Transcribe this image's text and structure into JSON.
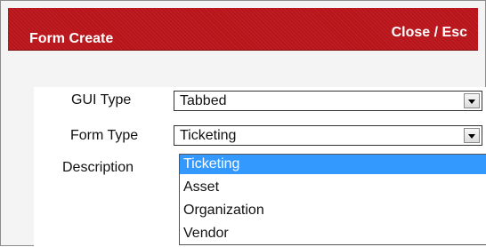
{
  "dialog": {
    "title": "Form Create",
    "close_label": "Close / Esc"
  },
  "form": {
    "gui_type": {
      "label": "GUI Type",
      "value": "Tabbed"
    },
    "form_type": {
      "label": "Form Type",
      "value": "Ticketing"
    },
    "description": {
      "label": "Description"
    }
  },
  "dropdown": {
    "options": [
      "Ticketing",
      "Asset",
      "Organization",
      "Vendor"
    ],
    "selected": "Ticketing"
  },
  "colors": {
    "titlebar": "#b8141a",
    "selection": "#3399ff"
  },
  "icons": {
    "dropdown_arrow": "chevron-down-icon"
  }
}
